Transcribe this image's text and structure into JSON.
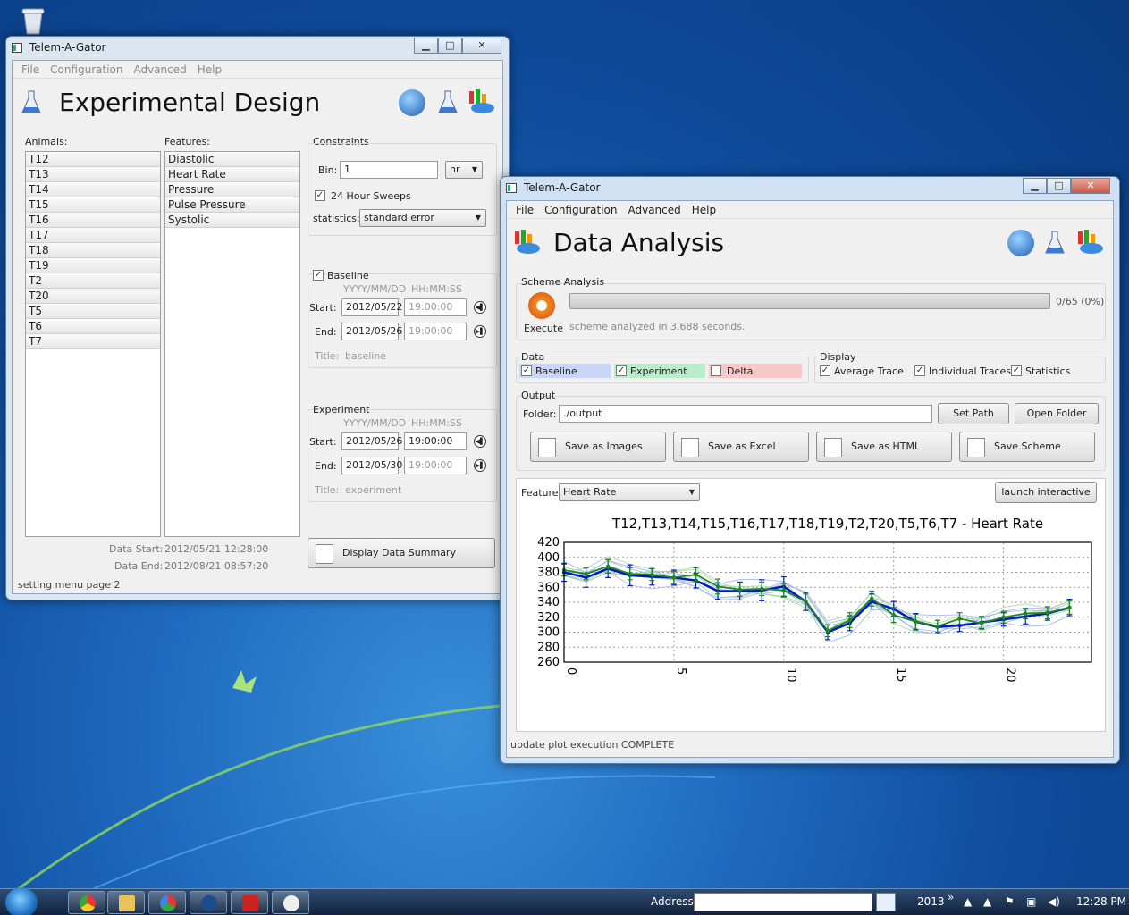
{
  "desktop": {
    "recycle_bin": "recycle-bin-icon"
  },
  "left_window": {
    "title": "Telem-A-Gator",
    "menu": [
      "File",
      "Configuration",
      "Advanced",
      "Help"
    ],
    "heading": "Experimental Design",
    "animals_label": "Animals:",
    "animals": [
      "T12",
      "T13",
      "T14",
      "T15",
      "T16",
      "T17",
      "T18",
      "T19",
      "T2",
      "T20",
      "T5",
      "T6",
      "T7"
    ],
    "features_label": "Features:",
    "features": [
      "Diastolic",
      "Heart Rate",
      "Pressure",
      "Pulse Pressure",
      "Systolic"
    ],
    "constraints": {
      "label": "Constraints",
      "bin_label": "Bin:",
      "bin_value": "1",
      "bin_unit": "hr",
      "sweeps_label": "24 Hour Sweeps",
      "sweeps_checked": true,
      "statistics_label": "statistics:",
      "statistics_value": "standard error"
    },
    "baseline": {
      "label": "Baseline",
      "checked": true,
      "date_fmt": "YYYY/MM/DD",
      "time_fmt": "HH:MM:SS",
      "start_label": "Start:",
      "start_date": "2012/05/22",
      "start_time": "19:00:00",
      "end_label": "End:",
      "end_date": "2012/05/26",
      "end_time": "19:00:00",
      "title_label": "Title:",
      "title_value": "baseline"
    },
    "experiment": {
      "label": "Experiment",
      "date_fmt": "YYYY/MM/DD",
      "time_fmt": "HH:MM:SS",
      "start_label": "Start:",
      "start_date": "2012/05/26",
      "start_time": "19:00:00",
      "end_label": "End:",
      "end_date": "2012/05/30",
      "end_time": "19:00:00",
      "title_label": "Title:",
      "title_value": "experiment"
    },
    "data_start_label": "Data Start:",
    "data_start": "2012/05/21 12:28:00",
    "data_end_label": "Data End:",
    "data_end": "2012/08/21 08:57:20",
    "summary_button": "Display Data Summary",
    "status": "setting menu page 2"
  },
  "right_window": {
    "title": "Telem-A-Gator",
    "menu": [
      "File",
      "Configuration",
      "Advanced",
      "Help"
    ],
    "heading": "Data Analysis",
    "scheme": {
      "label": "Scheme Analysis",
      "execute": "Execute",
      "progress_text": "0/65 (0%)",
      "progress": 0,
      "message": "scheme analyzed in 3.688 seconds."
    },
    "data_group": {
      "label": "Data",
      "baseline": "Baseline",
      "experiment": "Experiment",
      "delta": "Delta",
      "baseline_checked": true,
      "experiment_checked": true,
      "delta_checked": false,
      "baseline_color": "#c9d6f7",
      "experiment_color": "#b9ecc8",
      "delta_color": "#f8c8c8"
    },
    "display_group": {
      "label": "Display",
      "avg": "Average Trace",
      "indiv": "Individual Traces",
      "stats": "Statistics"
    },
    "output": {
      "label": "Output",
      "folder_label": "Folder:",
      "folder_value": "./output",
      "set_path": "Set Path",
      "open_folder": "Open Folder",
      "save_images": "Save as Images",
      "save_excel": "Save as Excel",
      "save_html": "Save as HTML",
      "save_scheme": "Save Scheme"
    },
    "feature_label": "Feature:",
    "feature_value": "Heart Rate",
    "launch": "launch interactive",
    "status": "update plot execution COMPLETE"
  },
  "chart_data": {
    "type": "line",
    "title": "T12,T13,T14,T15,T16,T17,T18,T19,T2,T20,T5,T6,T7 - Heart Rate",
    "xlim": [
      0,
      24
    ],
    "ylim": [
      260,
      420
    ],
    "xticks": [
      "0",
      "5",
      "10",
      "15",
      "20"
    ],
    "yticks": [
      "420",
      "400",
      "380",
      "360",
      "340",
      "320",
      "300",
      "280",
      "260"
    ],
    "x": [
      0,
      1,
      2,
      3,
      4,
      5,
      6,
      7,
      8,
      9,
      10,
      11,
      12,
      13,
      14,
      15,
      16,
      17,
      18,
      19,
      20,
      21,
      22,
      23
    ],
    "series": [
      {
        "color": "#0018c8",
        "values": [
          380,
          373,
          385,
          376,
          374,
          373,
          369,
          355,
          355,
          356,
          361,
          341,
          300,
          312,
          341,
          331,
          314,
          307,
          309,
          313,
          317,
          321,
          325,
          333
        ],
        "err": [
          12,
          13,
          12,
          14,
          11,
          10,
          10,
          11,
          12,
          14,
          13,
          12,
          10,
          10,
          10,
          10,
          11,
          9,
          8,
          8,
          9,
          10,
          9,
          11
        ]
      },
      {
        "color": "#1a8a1a",
        "values": [
          383,
          378,
          388,
          378,
          377,
          373,
          377,
          361,
          357,
          358,
          356,
          341,
          302,
          316,
          345,
          323,
          314,
          308,
          318,
          312,
          320,
          325,
          326,
          333
        ],
        "err": [
          8,
          8,
          9,
          8,
          8,
          8,
          9,
          10,
          9,
          9,
          9,
          10,
          8,
          10,
          10,
          10,
          10,
          8,
          8,
          8,
          8,
          7,
          8,
          9
        ]
      }
    ]
  },
  "taskbar": {
    "address_label": "Address",
    "year": "2013",
    "clock": "12:28 PM"
  }
}
